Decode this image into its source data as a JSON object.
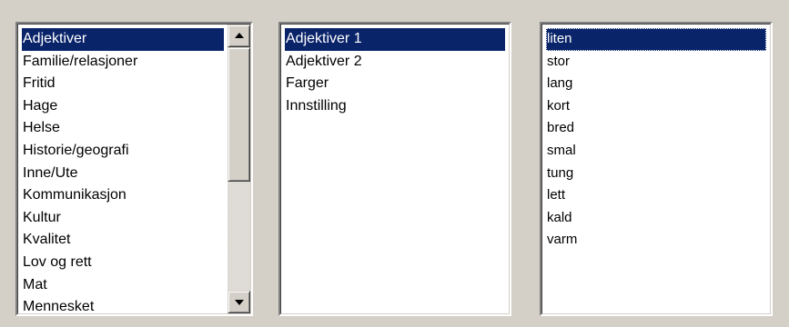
{
  "categories": {
    "items": [
      "Adjektiver",
      "Familie/relasjoner",
      "Fritid",
      "Hage",
      "Helse",
      "Historie/geografi",
      "Inne/Ute",
      "Kommunikasjon",
      "Kultur",
      "Kvalitet",
      "Lov og rett",
      "Mat",
      "Mennesket"
    ],
    "selected_index": 0
  },
  "subcategories": {
    "items": [
      "Adjektiver 1",
      "Adjektiver 2",
      "Farger",
      "Innstilling"
    ],
    "selected_index": 0
  },
  "words": {
    "items": [
      "liten",
      "stor",
      "lang",
      "kort",
      "bred",
      "smal",
      "tung",
      "lett",
      "kald",
      "varm"
    ],
    "selected_index": 0
  },
  "scrollbar": {
    "up_icon": "scroll-up-arrow-icon",
    "down_icon": "scroll-down-arrow-icon"
  },
  "colors": {
    "selection_bg": "#0a246a",
    "selection_text": "#ffffff",
    "window_bg": "#d4d0c8",
    "list_bg": "#ffffff"
  }
}
